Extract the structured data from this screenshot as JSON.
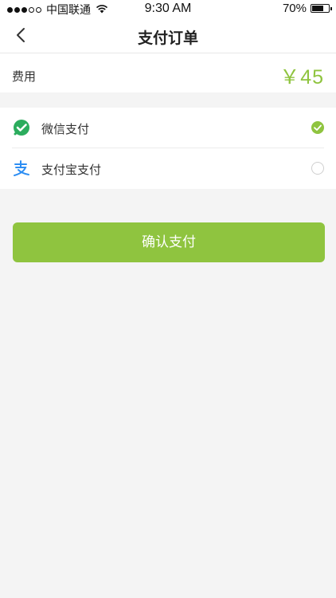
{
  "status_bar": {
    "carrier": "中国联通",
    "time": "9:30 AM",
    "battery": "70%",
    "signal_bars_filled": 3,
    "signal_bars_total": 5
  },
  "nav": {
    "title": "支付订单",
    "back_icon": "chevron-left-icon"
  },
  "fee": {
    "label": "费用",
    "amount": "￥45"
  },
  "payment_methods": [
    {
      "label": "微信支付",
      "icon": "wechat-pay-icon",
      "selected": true
    },
    {
      "label": "支付宝支付",
      "icon": "alipay-icon",
      "selected": false
    }
  ],
  "confirm_button": {
    "label": "确认支付"
  },
  "colors": {
    "accent": "#8fc43f",
    "wechat_green": "#2bac5d",
    "alipay_blue": "#2d8ef3"
  }
}
